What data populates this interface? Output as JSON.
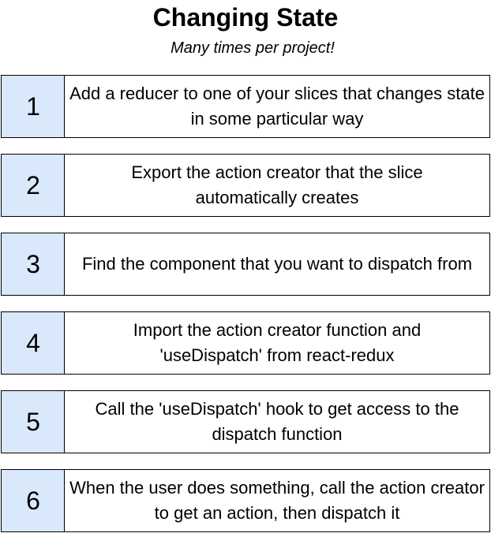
{
  "title": "Changing State",
  "subtitle": "Many times per project!",
  "steps": [
    {
      "number": "1",
      "text": "Add a reducer to one of your slices that changes state in some particular way"
    },
    {
      "number": "2",
      "text": "Export the action creator that the slice automatically creates"
    },
    {
      "number": "3",
      "text": "Find the component that you want to dispatch from"
    },
    {
      "number": "4",
      "text": "Import the action creator function and 'useDispatch' from react-redux"
    },
    {
      "number": "5",
      "text": "Call the 'useDispatch' hook to get access to the dispatch function"
    },
    {
      "number": "6",
      "text": "When the user does something, call the action creator to get an action, then dispatch it"
    }
  ],
  "colors": {
    "number_box_fill": "#dae8fc",
    "border": "#000000",
    "text_box_fill": "#ffffff"
  }
}
